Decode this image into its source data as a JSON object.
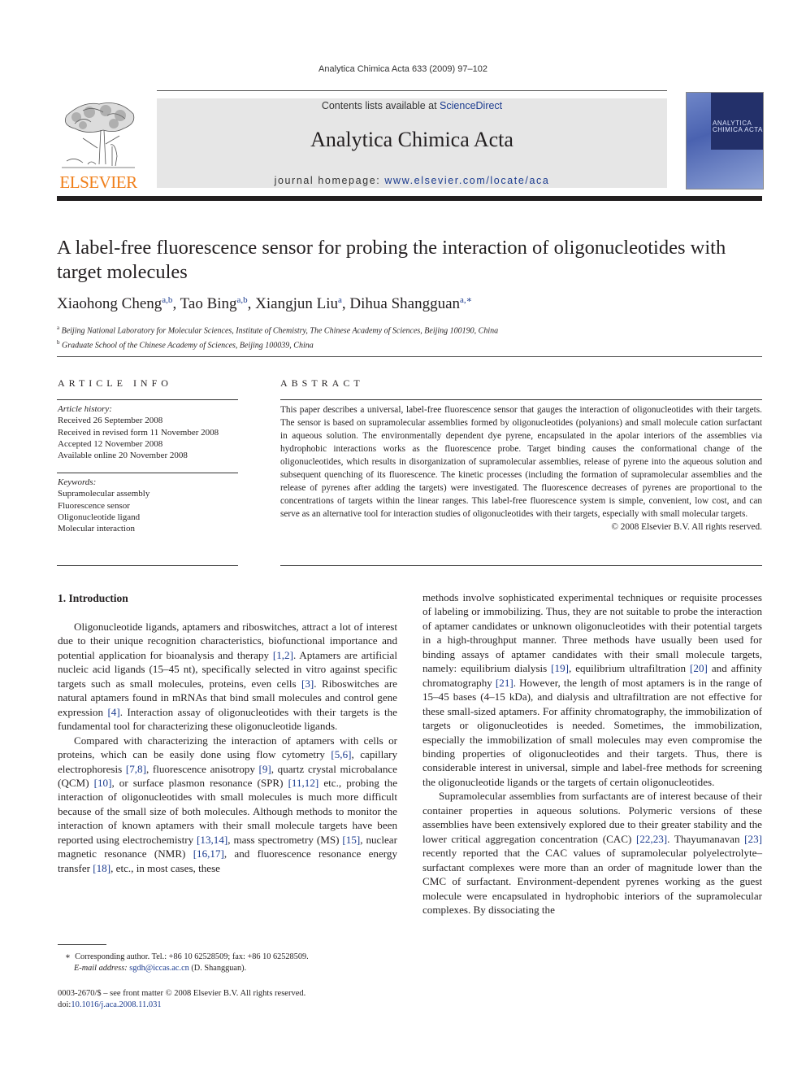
{
  "header": {
    "running_head": "Analytica Chimica Acta 633 (2009) 97–102",
    "contents_prefix": "Contents lists available at ",
    "contents_link": "ScienceDirect",
    "journal_title": "Analytica Chimica Acta",
    "homepage_prefix": "journal homepage: ",
    "homepage_link": "www.elsevier.com/locate/aca",
    "publisher_logo_text": "ELSEVIER",
    "cover_title_line1": "ANALYTICA",
    "cover_title_line2": "CHIMICA ACTA"
  },
  "colors": {
    "link_blue": "#1b3b8f",
    "elsevier_orange": "#f07f1a",
    "banner_gray": "#e6e6e6"
  },
  "article": {
    "title": "A label-free fluorescence sensor for probing the interaction of oligonucleotides with target molecules",
    "authors": [
      {
        "name": "Xiaohong Cheng",
        "sup": "a,b",
        "sep": ", "
      },
      {
        "name": "Tao Bing",
        "sup": "a,b",
        "sep": ", "
      },
      {
        "name": "Xiangjun Liu",
        "sup": "a",
        "sep": ", "
      },
      {
        "name": "Dihua Shangguan",
        "sup": "a,∗",
        "sep": ""
      }
    ],
    "affiliations": [
      {
        "mark": "a",
        "text": "Beijing National Laboratory for Molecular Sciences, Institute of Chemistry, The Chinese Academy of Sciences, Beijing 100190, China"
      },
      {
        "mark": "b",
        "text": "Graduate School of the Chinese Academy of Sciences, Beijing 100039, China"
      }
    ]
  },
  "article_info": {
    "heading": "ARTICLE INFO",
    "history_label": "Article history:",
    "history": [
      "Received 26 September 2008",
      "Received in revised form 11 November 2008",
      "Accepted 12 November 2008",
      "Available online 20 November 2008"
    ],
    "keywords_label": "Keywords:",
    "keywords": [
      "Supramolecular assembly",
      "Fluorescence sensor",
      "Oligonucleotide ligand",
      "Molecular interaction"
    ]
  },
  "abstract": {
    "heading": "ABSTRACT",
    "text": "This paper describes a universal, label-free fluorescence sensor that gauges the interaction of oligonucleotides with their targets. The sensor is based on supramolecular assemblies formed by oligonucleotides (polyanions) and small molecule cation surfactant in aqueous solution. The environmentally dependent dye pyrene, encapsulated in the apolar interiors of the assemblies via hydrophobic interactions works as the fluorescence probe. Target binding causes the conformational change of the oligonucleotides, which results in disorganization of supramolecular assemblies, release of pyrene into the aqueous solution and subsequent quenching of its fluorescence. The kinetic processes (including the formation of supramolecular assemblies and the release of pyrenes after adding the targets) were investigated. The fluorescence decreases of pyrenes are proportional to the concentrations of targets within the linear ranges. This label-free fluorescence system is simple, convenient, low cost, and can serve as an alternative tool for interaction studies of oligonucleotides with their targets, especially with small molecular targets.",
    "copyright": "© 2008 Elsevier B.V. All rights reserved."
  },
  "body": {
    "section_title": "1.  Introduction",
    "paragraphs": [
      [
        {
          "t": "Oligonucleotide ligands, aptamers and riboswitches, attract a lot of interest due to their unique recognition characteristics, biofunctional importance and potential application for bioanalysis and therapy "
        },
        {
          "r": "[1,2]"
        },
        {
          "t": ". Aptamers are artificial nucleic acid ligands (15–45 nt), specifically selected in vitro against specific targets such as small molecules, proteins, even cells "
        },
        {
          "r": "[3]"
        },
        {
          "t": ". Riboswitches are natural aptamers found in mRNAs that bind small molecules and control gene expression "
        },
        {
          "r": "[4]"
        },
        {
          "t": ". Interaction assay of oligonucleotides with their targets is the fundamental tool for characterizing these oligonucleotide ligands."
        }
      ],
      [
        {
          "t": "Compared with characterizing the interaction of aptamers with cells or proteins, which can be easily done using flow cytometry "
        },
        {
          "r": "[5,6]"
        },
        {
          "t": ", capillary electrophoresis "
        },
        {
          "r": "[7,8]"
        },
        {
          "t": ", fluorescence anisotropy "
        },
        {
          "r": "[9]"
        },
        {
          "t": ", quartz crystal microbalance (QCM) "
        },
        {
          "r": "[10]"
        },
        {
          "t": ", or surface plasmon resonance (SPR) "
        },
        {
          "r": "[11,12]"
        },
        {
          "t": " etc., probing the interaction of oligonucleotides with small molecules is much more difficult because of the small size of both molecules. Although methods to monitor the interaction of known aptamers with their small molecule targets have been reported using electrochemistry "
        },
        {
          "r": "[13,14]"
        },
        {
          "t": ", mass spectrometry (MS) "
        },
        {
          "r": "[15]"
        },
        {
          "t": ", nuclear magnetic resonance (NMR) "
        },
        {
          "r": "[16,17]"
        },
        {
          "t": ", and fluorescence resonance energy transfer "
        },
        {
          "r": "[18]"
        },
        {
          "t": ", etc., in most cases, these"
        }
      ]
    ],
    "right_paragraphs": [
      [
        {
          "t": "methods involve sophisticated experimental techniques or requisite processes of labeling or immobilizing. Thus, they are not suitable to probe the interaction of aptamer candidates or unknown oligonucleotides with their potential targets in a high-throughput manner. Three methods have usually been used for binding assays of aptamer candidates with their small molecule targets, namely: equilibrium dialysis "
        },
        {
          "r": "[19]"
        },
        {
          "t": ", equilibrium ultrafiltration "
        },
        {
          "r": "[20]"
        },
        {
          "t": " and affinity chromatography "
        },
        {
          "r": "[21]"
        },
        {
          "t": ". However, the length of most aptamers is in the range of 15–45 bases (4–15 kDa), and dialysis and ultrafiltration are not effective for these small-sized aptamers. For affinity chromatography, the immobilization of targets or oligonucleotides is needed. Sometimes, the immobilization, especially the immobilization of small molecules may even compromise the binding properties of oligonucleotides and their targets. Thus, there is considerable interest in universal, simple and label-free methods for screening the oligonucleotide ligands or the targets of certain oligonucleotides."
        }
      ],
      [
        {
          "t": "Supramolecular assemblies from surfactants are of interest because of their container properties in aqueous solutions. Polymeric versions of these assemblies have been extensively explored due to their greater stability and the lower critical aggregation concentration (CAC) "
        },
        {
          "r": "[22,23]"
        },
        {
          "t": ". Thayumanavan "
        },
        {
          "r": "[23]"
        },
        {
          "t": " recently reported that the CAC values of supramolecular polyelectrolyte–surfactant complexes were more than an order of magnitude lower than the CMC of surfactant. Environment-dependent pyrenes working as the guest molecule were encapsulated in hydrophobic interiors of the supramolecular complexes. By dissociating the"
        }
      ]
    ]
  },
  "footnote": {
    "star": "∗",
    "corresponding": "Corresponding author. Tel.: +86 10 62528509; fax: +86 10 62528509.",
    "email_label": "E-mail address:",
    "email": "sgdh@iccas.ac.cn",
    "email_suffix": " (D. Shangguan)."
  },
  "front_matter": {
    "issn_line": "0003-2670/$ – see front matter © 2008 Elsevier B.V. All rights reserved.",
    "doi_prefix": "doi:",
    "doi": "10.1016/j.aca.2008.11.031"
  }
}
